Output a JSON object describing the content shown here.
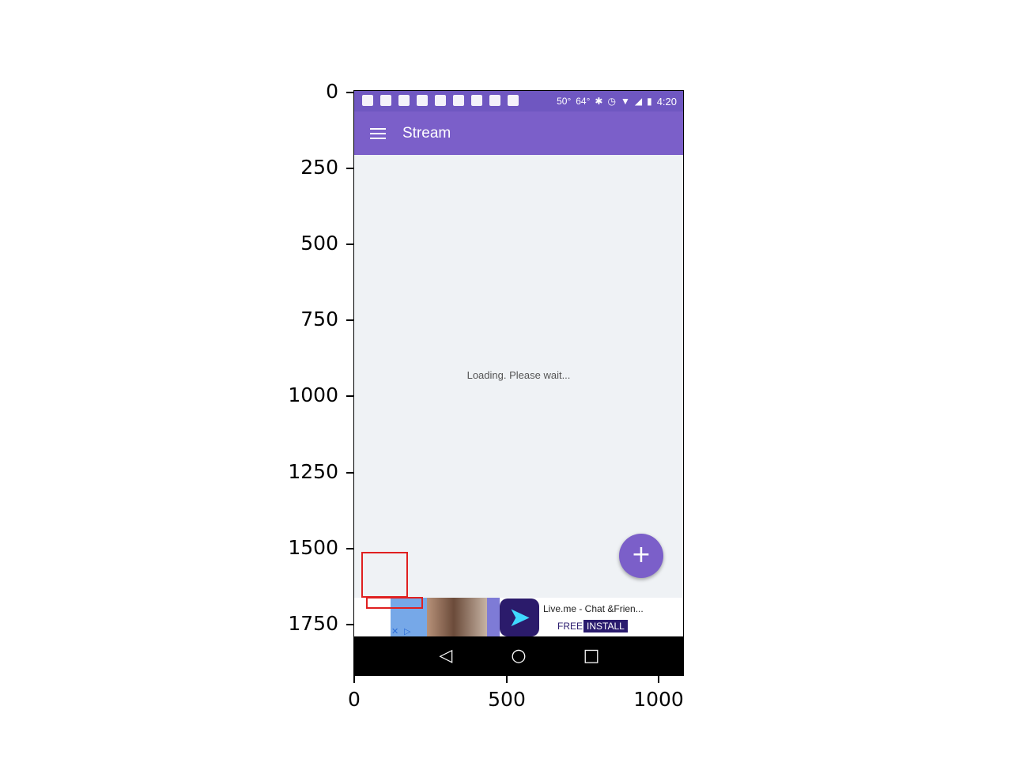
{
  "axes": {
    "y_ticks": [
      "0",
      "250",
      "500",
      "750",
      "1000",
      "1250",
      "1500",
      "1750"
    ],
    "x_ticks": [
      "0",
      "500",
      "1000"
    ]
  },
  "status_bar": {
    "temp1": "50°",
    "temp2": "64°",
    "time": "4:20"
  },
  "app_bar": {
    "menu_icon": "hamburger-menu-icon",
    "title": "Stream"
  },
  "main": {
    "loading_text": "Loading. Please wait..."
  },
  "fab": {
    "symbol": "+",
    "icon": "add-icon"
  },
  "ad": {
    "app_name": "Live.me - Chat &Frien...",
    "free_label": "FREE",
    "install_label": "INSTALL"
  },
  "nav_bar": {
    "back": "◁",
    "home": "○",
    "recent": "□"
  },
  "colors": {
    "primary": "#7b5fc9",
    "status_bar": "#6f57c1",
    "background": "#eff2f5",
    "annotation": "#e02020"
  }
}
